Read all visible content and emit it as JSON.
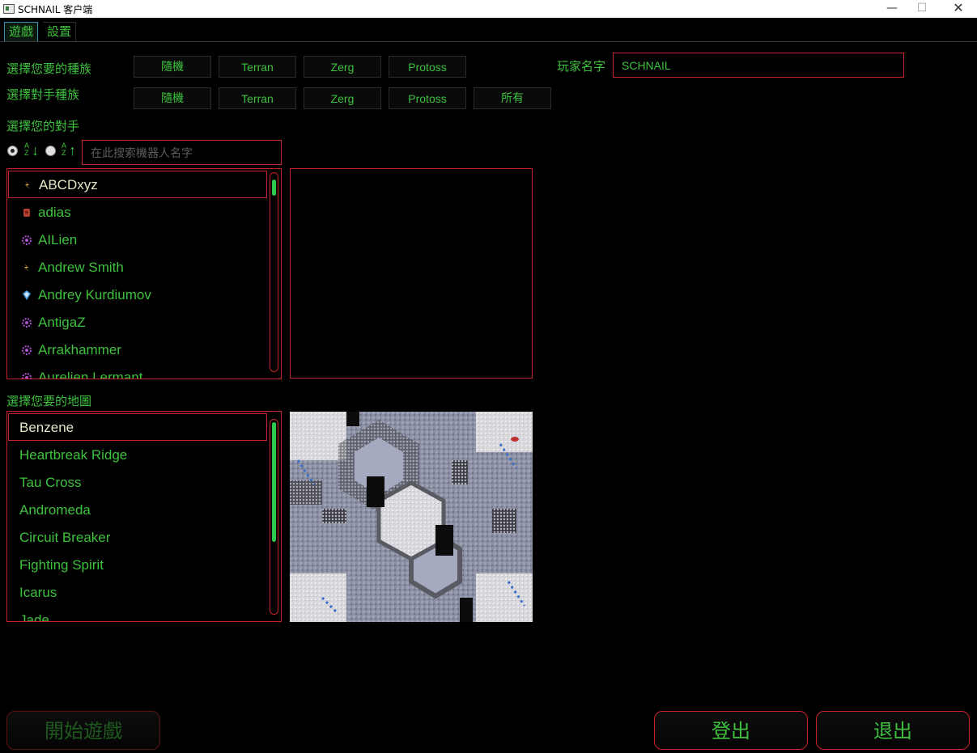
{
  "window": {
    "title": "SCHNAIL 客户端",
    "minimize_glyph": "—",
    "maximize_glyph": "☐",
    "close_glyph": "✕"
  },
  "tabs": [
    {
      "label": "遊戲",
      "active": true
    },
    {
      "label": "設置",
      "active": false
    }
  ],
  "race_selection": {
    "my_race_label": "選擇您要的種族",
    "my_races": [
      "隨機",
      "Terran",
      "Zerg",
      "Protoss"
    ],
    "opponent_race_label": "選擇對手種族",
    "opponent_races": [
      "隨機",
      "Terran",
      "Zerg",
      "Protoss",
      "所有"
    ]
  },
  "player": {
    "name_label": "玩家名字",
    "name_value": "SCHNAIL"
  },
  "opponents": {
    "label": "選擇您的對手",
    "sort_asc_label": "AZ↓",
    "sort_desc_label": "AZ↑",
    "search_placeholder": "在此搜索機器人名字",
    "items": [
      {
        "name": "ABCDxyz",
        "race": "terran",
        "selected": true
      },
      {
        "name": "adias",
        "race": "terran-red"
      },
      {
        "name": "AILien",
        "race": "zerg"
      },
      {
        "name": "Andrew Smith",
        "race": "terran"
      },
      {
        "name": "Andrey Kurdiumov",
        "race": "protoss"
      },
      {
        "name": "AntigaZ",
        "race": "zerg"
      },
      {
        "name": "Arrakhammer",
        "race": "zerg"
      },
      {
        "name": "Aurelien Lermant",
        "race": "zerg"
      }
    ],
    "scroll_fraction": 0.0
  },
  "maps": {
    "label": "選擇您要的地圖",
    "items": [
      {
        "name": "Benzene",
        "selected": true
      },
      {
        "name": "Heartbreak Ridge"
      },
      {
        "name": "Tau Cross"
      },
      {
        "name": "Andromeda"
      },
      {
        "name": "Circuit Breaker"
      },
      {
        "name": "Fighting Spirit"
      },
      {
        "name": "Icarus"
      },
      {
        "name": "Jade"
      }
    ]
  },
  "actions": {
    "start_game": "開始遊戲",
    "logout": "登出",
    "exit": "退出"
  },
  "colors": {
    "text_green": "#3ec13e",
    "border_red": "#c8232c",
    "scroll_green": "#2ec84f",
    "tab_blue": "#3a8fb7"
  }
}
